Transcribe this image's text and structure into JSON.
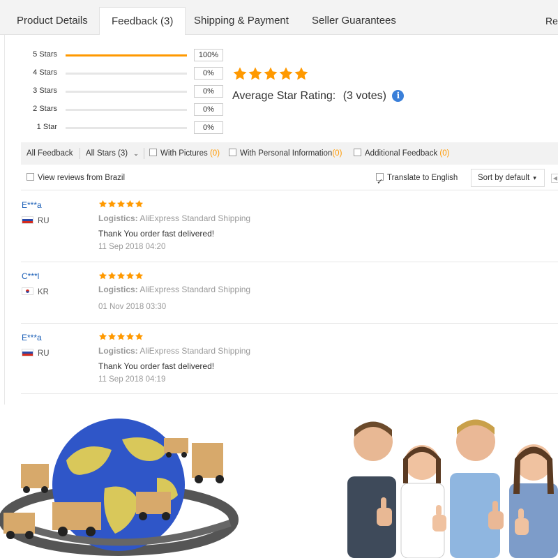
{
  "tabs": [
    {
      "label": "Product Details",
      "active": false
    },
    {
      "label": "Feedback (3)",
      "active": true
    },
    {
      "label": "Shipping & Payment",
      "active": false
    },
    {
      "label": "Seller Guarantees",
      "active": false
    }
  ],
  "tab_more": "Rep",
  "histogram": [
    {
      "label": "5 Stars",
      "percent": "100%",
      "fill": 1.0
    },
    {
      "label": "4 Stars",
      "percent": "0%",
      "fill": 0
    },
    {
      "label": "3 Stars",
      "percent": "0%",
      "fill": 0
    },
    {
      "label": "2 Stars",
      "percent": "0%",
      "fill": 0
    },
    {
      "label": "1 Star",
      "percent": "0%",
      "fill": 0
    }
  ],
  "average": {
    "stars": 5,
    "label": "Average Star Rating:",
    "votes": "(3 votes)",
    "info_icon": "info-icon"
  },
  "filters": {
    "all_feedback": "All Feedback",
    "all_stars": "All Stars (3)",
    "with_pictures": "With Pictures",
    "with_pictures_count": "0",
    "with_personal": "With Personal Information",
    "with_personal_count": "0",
    "additional": "Additional Feedback",
    "additional_count": "0",
    "view_from": "View reviews from Brazil",
    "translate": "Translate to English",
    "translate_checked": true,
    "sort": "Sort by default"
  },
  "reviews": [
    {
      "user": "E***a",
      "country": "RU",
      "flag": "ru",
      "stars": 5,
      "logistics_label": "Logistics:",
      "logistics": "AliExpress Standard Shipping",
      "text": "Thank You order fast delivered!",
      "date": "11 Sep 2018 04:20"
    },
    {
      "user": "C***l",
      "country": "KR",
      "flag": "kr",
      "stars": 5,
      "logistics_label": "Logistics:",
      "logistics": "AliExpress Standard Shipping",
      "text": "",
      "date": "01 Nov 2018 03:30"
    },
    {
      "user": "E***a",
      "country": "RU",
      "flag": "ru",
      "stars": 5,
      "logistics_label": "Logistics:",
      "logistics": "AliExpress Standard Shipping",
      "text": "Thank You order fast delivered!",
      "date": "11 Sep 2018 04:19"
    }
  ],
  "colors": {
    "accent": "#ff9900",
    "link": "#1b5fb7",
    "info": "#3a7fd9"
  },
  "images": [
    {
      "name": "globe-shipping-illustration"
    },
    {
      "name": "thumbs-up-people-photo"
    }
  ]
}
